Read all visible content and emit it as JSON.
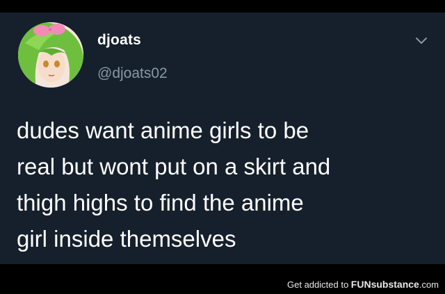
{
  "tweet": {
    "display_name": "djoats",
    "handle": "@djoats02",
    "text_lines": [
      "dudes want anime girls to be",
      "real but wont put on a skirt and",
      "thigh highs to find the anime",
      "girl inside themselves"
    ]
  },
  "icons": {
    "menu": "chevron-down-icon",
    "avatar": "anime-avatar-image"
  },
  "watermark": {
    "prefix": "Get addicted to ",
    "brand": "FUNsubstance",
    "suffix": ".com"
  },
  "colors": {
    "tweet_background": "#16202c",
    "name": "#ffffff",
    "handle": "#8899a6",
    "text": "#ffffff",
    "page_background": "#000000"
  }
}
